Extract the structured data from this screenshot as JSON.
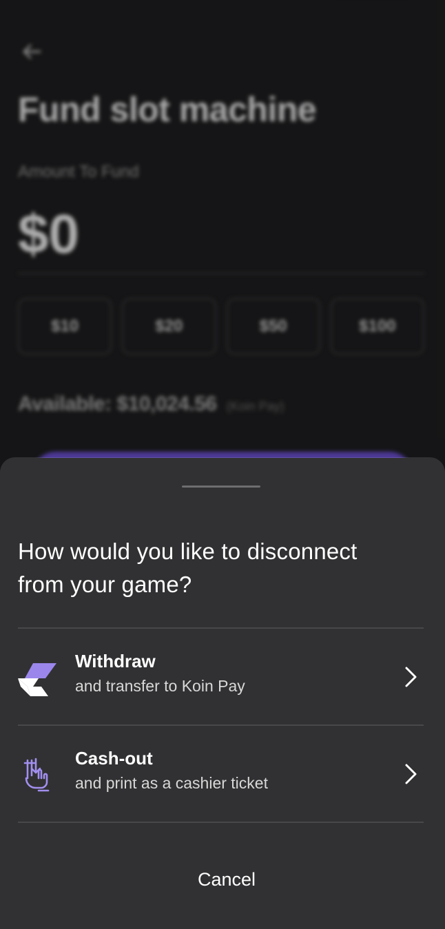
{
  "background_page": {
    "title": "Fund slot machine",
    "amount_label": "Amount To Fund",
    "amount_value": "$0",
    "quick_amounts": [
      "$10",
      "$20",
      "$50",
      "$100"
    ],
    "available_text": "Available: $10,024.56",
    "available_source": "(Koin Pay)",
    "icons": {
      "back": "arrow-left-icon"
    }
  },
  "sheet": {
    "title": "How would you like to disconnect from your game?",
    "options": [
      {
        "title": "Withdraw",
        "subtitle": "and transfer to Koin Pay",
        "icon": "koin-pay-logo-icon"
      },
      {
        "title": "Cash-out",
        "subtitle": "and print as a cashier ticket",
        "icon": "cash-out-hand-icon"
      }
    ],
    "cancel_label": "Cancel"
  },
  "colors": {
    "accent": "#9b87ec",
    "sheet_background": "#313133",
    "page_background": "#1e1e20"
  }
}
